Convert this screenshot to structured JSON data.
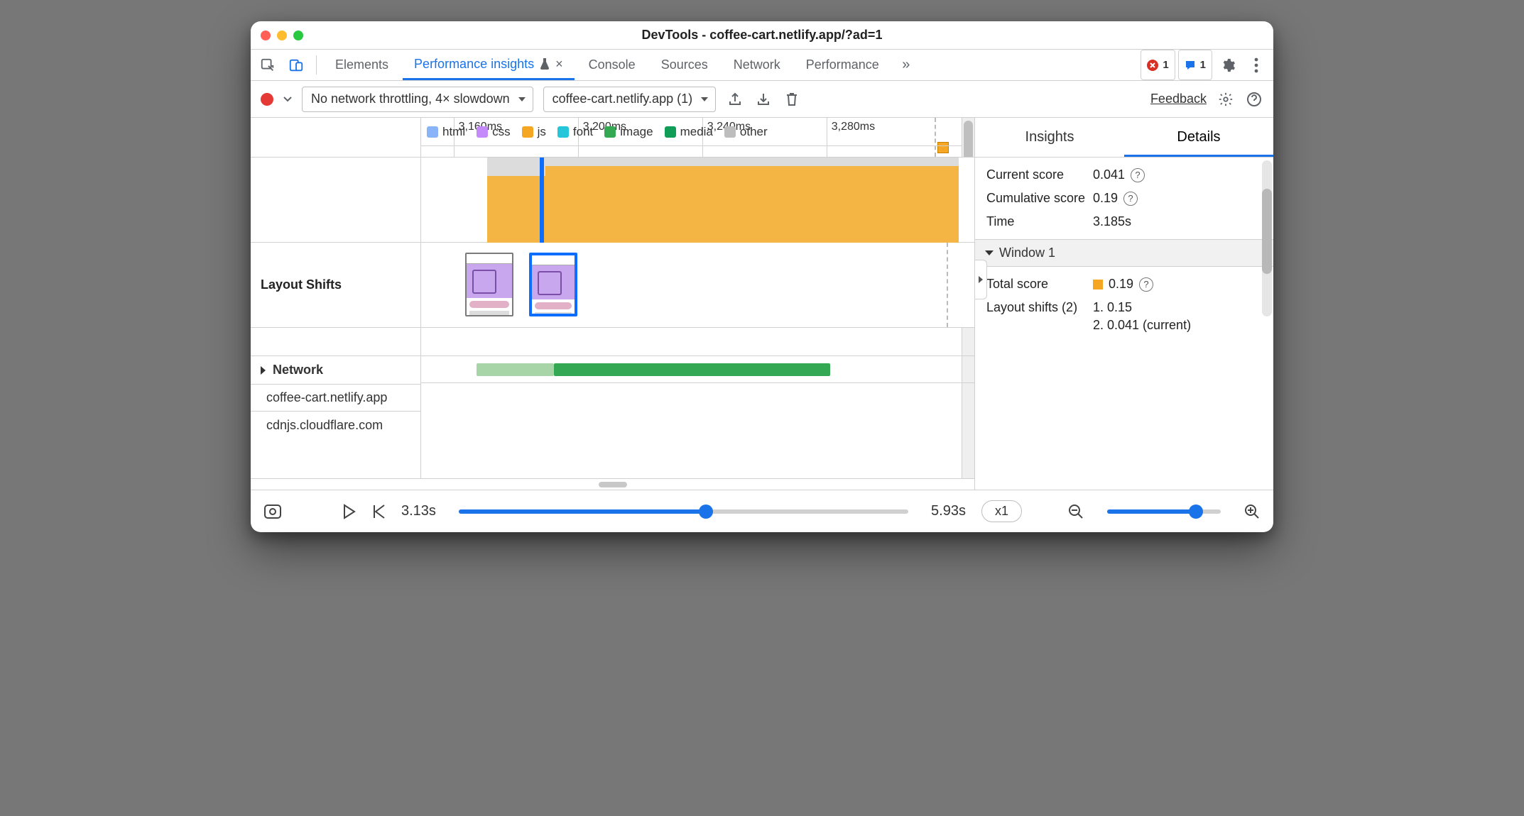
{
  "window": {
    "title": "DevTools - coffee-cart.netlify.app/?ad=1"
  },
  "tabs": {
    "items": [
      "Elements",
      "Performance insights",
      "Console",
      "Sources",
      "Network",
      "Performance"
    ],
    "active_index": 1,
    "errors_badge": "1",
    "messages_badge": "1"
  },
  "toolbar": {
    "throttling": "No network throttling, 4× slowdown",
    "recording": "coffee-cart.netlify.app (1)",
    "feedback": "Feedback"
  },
  "timeline": {
    "ticks": [
      "3,160ms",
      "3,200ms",
      "3,240ms",
      "3,280ms"
    ],
    "rows": {
      "layout_shifts": "Layout Shifts",
      "network": "Network",
      "hosts": [
        "coffee-cart.netlify.app",
        "cdnjs.cloudflare.com"
      ]
    },
    "legend": [
      {
        "label": "html",
        "color": "#8ab4f8"
      },
      {
        "label": "css",
        "color": "#c58af9"
      },
      {
        "label": "js",
        "color": "#f5a623"
      },
      {
        "label": "font",
        "color": "#26c6da"
      },
      {
        "label": "image",
        "color": "#34a853"
      },
      {
        "label": "media",
        "color": "#0f9d58"
      },
      {
        "label": "other",
        "color": "#bdbdbd"
      }
    ]
  },
  "details": {
    "tabs": {
      "insights": "Insights",
      "details": "Details"
    },
    "current_score_label": "Current score",
    "current_score_value": "0.041",
    "cumulative_score_label": "Cumulative score",
    "cumulative_score_value": "0.19",
    "time_label": "Time",
    "time_value": "3.185s",
    "window_header": "Window 1",
    "total_score_label": "Total score",
    "total_score_value": "0.19",
    "layout_shifts_label": "Layout shifts (2)",
    "shifts": {
      "first": "1. 0.15",
      "second": "2. 0.041 (current)"
    }
  },
  "controls": {
    "start": "3.13s",
    "end": "5.93s",
    "speed": "x1"
  }
}
